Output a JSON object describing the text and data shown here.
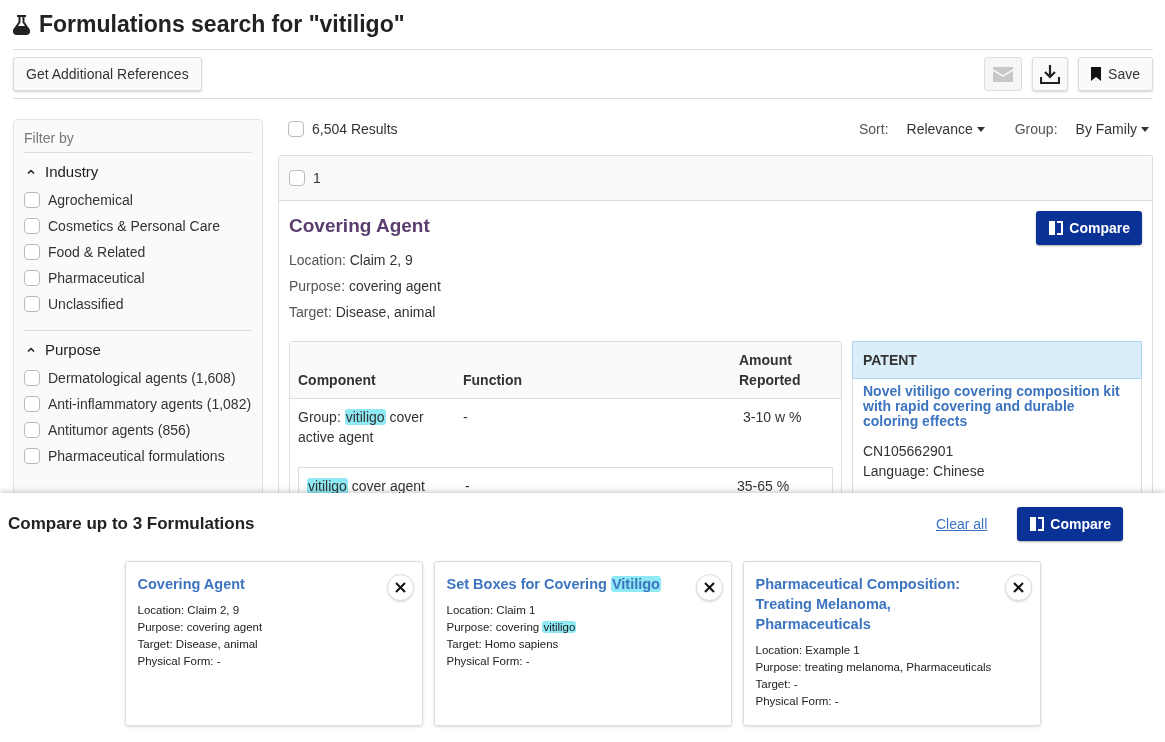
{
  "title": "Formulations search for \"vitiligo\"",
  "toolbar": {
    "additional_button": "Get Additional References",
    "email_disabled": true,
    "save_button": "Save"
  },
  "filters": {
    "heading": "Filter by",
    "sections": [
      {
        "title": "Industry",
        "expanded": true,
        "options": [
          {
            "label": "Agrochemical",
            "checked": false
          },
          {
            "label": "Cosmetics & Personal Care",
            "checked": false
          },
          {
            "label": "Food & Related",
            "checked": false
          },
          {
            "label": "Pharmaceutical",
            "checked": false
          },
          {
            "label": "Unclassified",
            "checked": false
          }
        ]
      },
      {
        "title": "Purpose",
        "expanded": true,
        "options": [
          {
            "label": "Dermatological agents (1,608)",
            "checked": false
          },
          {
            "label": "Anti-inflammatory agents (1,082)",
            "checked": false
          },
          {
            "label": "Antitumor agents (856)",
            "checked": false
          },
          {
            "label": "Pharmaceutical formulations",
            "checked": false
          }
        ]
      }
    ]
  },
  "results": {
    "select_all_checked": false,
    "count": "6,504 Results",
    "sort_label": "Sort:",
    "sort_value": "Relevance",
    "group_label": "Group:",
    "group_value": "By Family"
  },
  "family": {
    "number": "1",
    "checked": false,
    "title": "Covering Agent",
    "compare_button": "Compare",
    "fields": [
      {
        "label": "Location:",
        "value": "Claim 2, 9"
      },
      {
        "label": "Purpose:",
        "value": "covering agent"
      },
      {
        "label": "Target:",
        "value": "Disease, animal"
      }
    ],
    "table": {
      "columns": [
        "Component",
        "Function",
        "Amount Reported"
      ],
      "rows": [
        {
          "nested": false,
          "component": [
            {
              "text": "Group: ",
              "highlight": false
            },
            {
              "text": "vitiligo",
              "highlight": true
            },
            {
              "text": " cover active agent",
              "highlight": false
            }
          ],
          "function": "-",
          "amount": "3-10 w %"
        },
        {
          "nested": true,
          "component": [
            {
              "text": "vitiligo",
              "highlight": true
            },
            {
              "text": " cover agent",
              "highlight": false
            }
          ],
          "function": "-",
          "amount": "35-65 %"
        }
      ]
    },
    "patent": {
      "heading": "PATENT",
      "title": "Novel vitiligo covering composition kit with rapid covering and durable coloring effects",
      "number": "CN105662901",
      "language": "Language: Chinese"
    }
  },
  "compare_panel": {
    "title": "Compare up to 3 Formulations",
    "clear_all": "Clear all",
    "compare_button": "Compare",
    "cards": [
      {
        "title": [
          {
            "text": "Covering Agent",
            "highlight": false
          }
        ],
        "lines": [
          [
            {
              "text": "Location: Claim 2, 9",
              "highlight": false
            }
          ],
          [
            {
              "text": "Purpose: covering agent",
              "highlight": false
            }
          ],
          [
            {
              "text": "Target: Disease, animal",
              "highlight": false
            }
          ],
          [
            {
              "text": "Physical Form: -",
              "highlight": false
            }
          ]
        ]
      },
      {
        "title": [
          {
            "text": "Set Boxes for Covering ",
            "highlight": false
          },
          {
            "text": "Vitiligo",
            "highlight": true
          }
        ],
        "lines": [
          [
            {
              "text": "Location: Claim 1",
              "highlight": false
            }
          ],
          [
            {
              "text": "Purpose: covering ",
              "highlight": false
            },
            {
              "text": "vitiligo",
              "highlight": true
            }
          ],
          [
            {
              "text": "Target: Homo sapiens",
              "highlight": false
            }
          ],
          [
            {
              "text": "Physical Form: -",
              "highlight": false
            }
          ]
        ]
      },
      {
        "title": [
          {
            "text": "Pharmaceutical Composition: Treating Melanoma, Pharmaceuticals",
            "highlight": false
          }
        ],
        "lines": [
          [
            {
              "text": "Location: Example 1",
              "highlight": false
            }
          ],
          [
            {
              "text": "Purpose: treating melanoma, Pharmaceuticals",
              "highlight": false
            }
          ],
          [
            {
              "text": "Target: -",
              "highlight": false
            }
          ],
          [
            {
              "text": "Physical Form: -",
              "highlight": false
            }
          ]
        ]
      }
    ]
  }
}
